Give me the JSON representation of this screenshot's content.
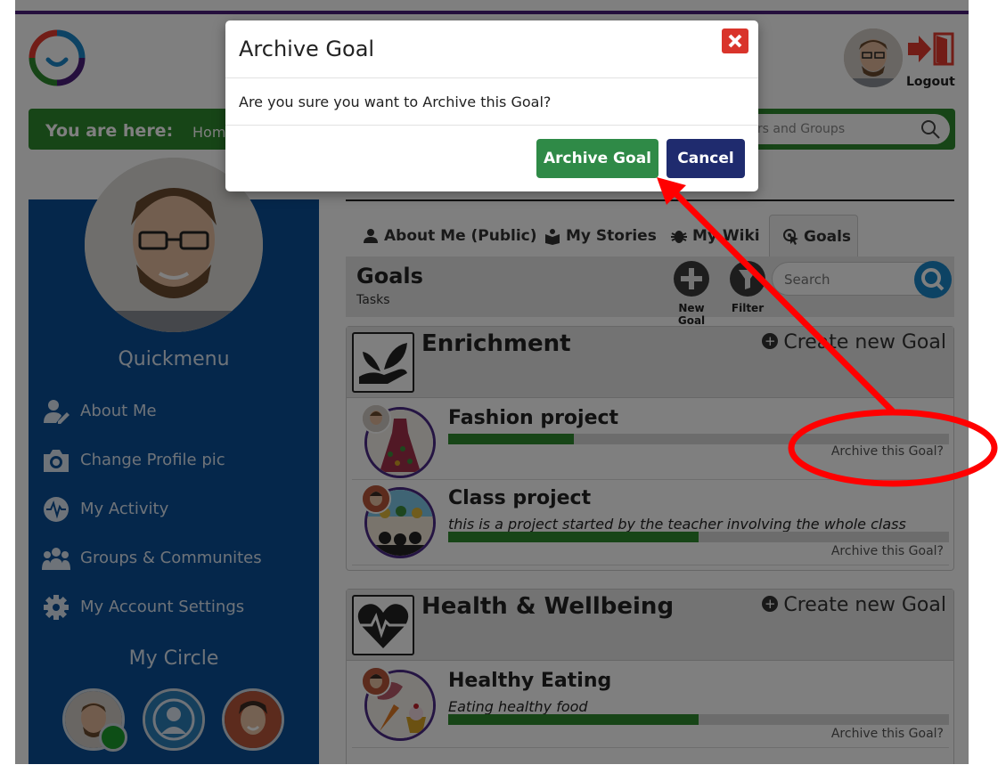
{
  "header": {
    "logout_label": "Logout"
  },
  "breadcrumb": {
    "label": "You are here:",
    "home": "Home",
    "search_placeholder": "sers and Groups"
  },
  "sidebar": {
    "quickmenu_title": "Quickmenu",
    "items": [
      {
        "label": "About Me",
        "icon": "user-edit-icon"
      },
      {
        "label": "Change Profile pic",
        "icon": "camera-icon"
      },
      {
        "label": "My Activity",
        "icon": "activity-pulse-icon"
      },
      {
        "label": "Groups & Communites",
        "icon": "users-icon"
      },
      {
        "label": "My Account Settings",
        "icon": "gear-icon"
      }
    ],
    "circle_title": "My Circle"
  },
  "tabs": [
    {
      "label": "About Me (Public)",
      "icon": "user-icon"
    },
    {
      "label": "My Stories",
      "icon": "stories-icon"
    },
    {
      "label": "My Wiki",
      "icon": "bug-icon"
    },
    {
      "label": "Goals",
      "icon": "target-pointer-icon",
      "active": true
    }
  ],
  "goals": {
    "title": "Goals",
    "subtitle": "Tasks",
    "new_goal_label": "New Goal",
    "filter_label": "Filter",
    "search_placeholder": "Search"
  },
  "categories": [
    {
      "title": "Enrichment",
      "create_label": "Create new Goal",
      "goals": [
        {
          "title": "Fashion project",
          "description": "",
          "progress": 0.25,
          "archive_label": "Archive this Goal?"
        },
        {
          "title": "Class project",
          "description": "this is a project started by the teacher involving the whole class",
          "progress": 0.5,
          "archive_label": "Archive this Goal?"
        }
      ]
    },
    {
      "title": "Health & Wellbeing",
      "create_label": "Create new Goal",
      "goals": [
        {
          "title": "Healthy Eating",
          "description": "Eating healthy food",
          "progress": 0.5,
          "archive_label": "Archive this Goal?"
        }
      ]
    }
  ],
  "modal": {
    "title": "Archive Goal",
    "body": "Are you sure you want to Archive this Goal?",
    "confirm_label": "Archive Goal",
    "cancel_label": "Cancel"
  },
  "colors": {
    "brand_green": "#2f8a2f",
    "sidebar_blue": "#0a4f96",
    "cancel_navy": "#1f2b6e",
    "close_red": "#d9342b",
    "annotation_red": "#ff0000"
  }
}
